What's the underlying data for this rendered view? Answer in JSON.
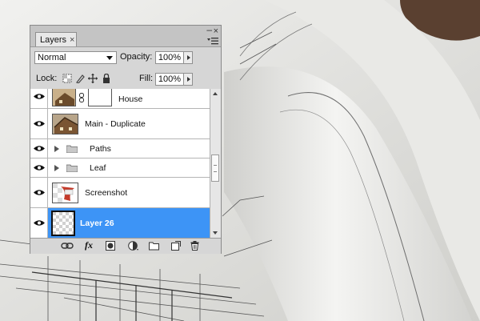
{
  "panel": {
    "tab_label": "Layers",
    "tab_close": "×",
    "minimize": "–",
    "close": "×"
  },
  "blend_mode": {
    "selected": "Normal"
  },
  "opacity": {
    "label": "Opacity:",
    "value": "100%"
  },
  "lock": {
    "label": "Lock:",
    "icons": [
      "lock-transparent-pixels-icon",
      "lock-image-pixels-icon",
      "lock-position-icon",
      "lock-all-icon"
    ]
  },
  "fill": {
    "label": "Fill:",
    "value": "100%"
  },
  "layers": [
    {
      "name": "House",
      "type": "layer-with-mask",
      "visible": true,
      "selected": false
    },
    {
      "name": "Main - Duplicate",
      "type": "layer",
      "visible": true,
      "selected": false
    },
    {
      "name": "Paths",
      "type": "group",
      "visible": true,
      "selected": false
    },
    {
      "name": "Leaf",
      "type": "group",
      "visible": true,
      "selected": false
    },
    {
      "name": "Screenshot",
      "type": "layer",
      "visible": true,
      "selected": false
    },
    {
      "name": "Layer 26",
      "type": "layer",
      "visible": true,
      "selected": true
    }
  ],
  "bottom_toolbar": {
    "fx_label": "fx",
    "icons": [
      "link-layers-icon",
      "fx-icon",
      "add-mask-icon",
      "adjustment-layer-icon",
      "new-group-icon",
      "new-layer-icon",
      "trash-icon"
    ]
  },
  "colors": {
    "selection": "#3d94f6",
    "panel_bg": "#d6d6d6"
  }
}
